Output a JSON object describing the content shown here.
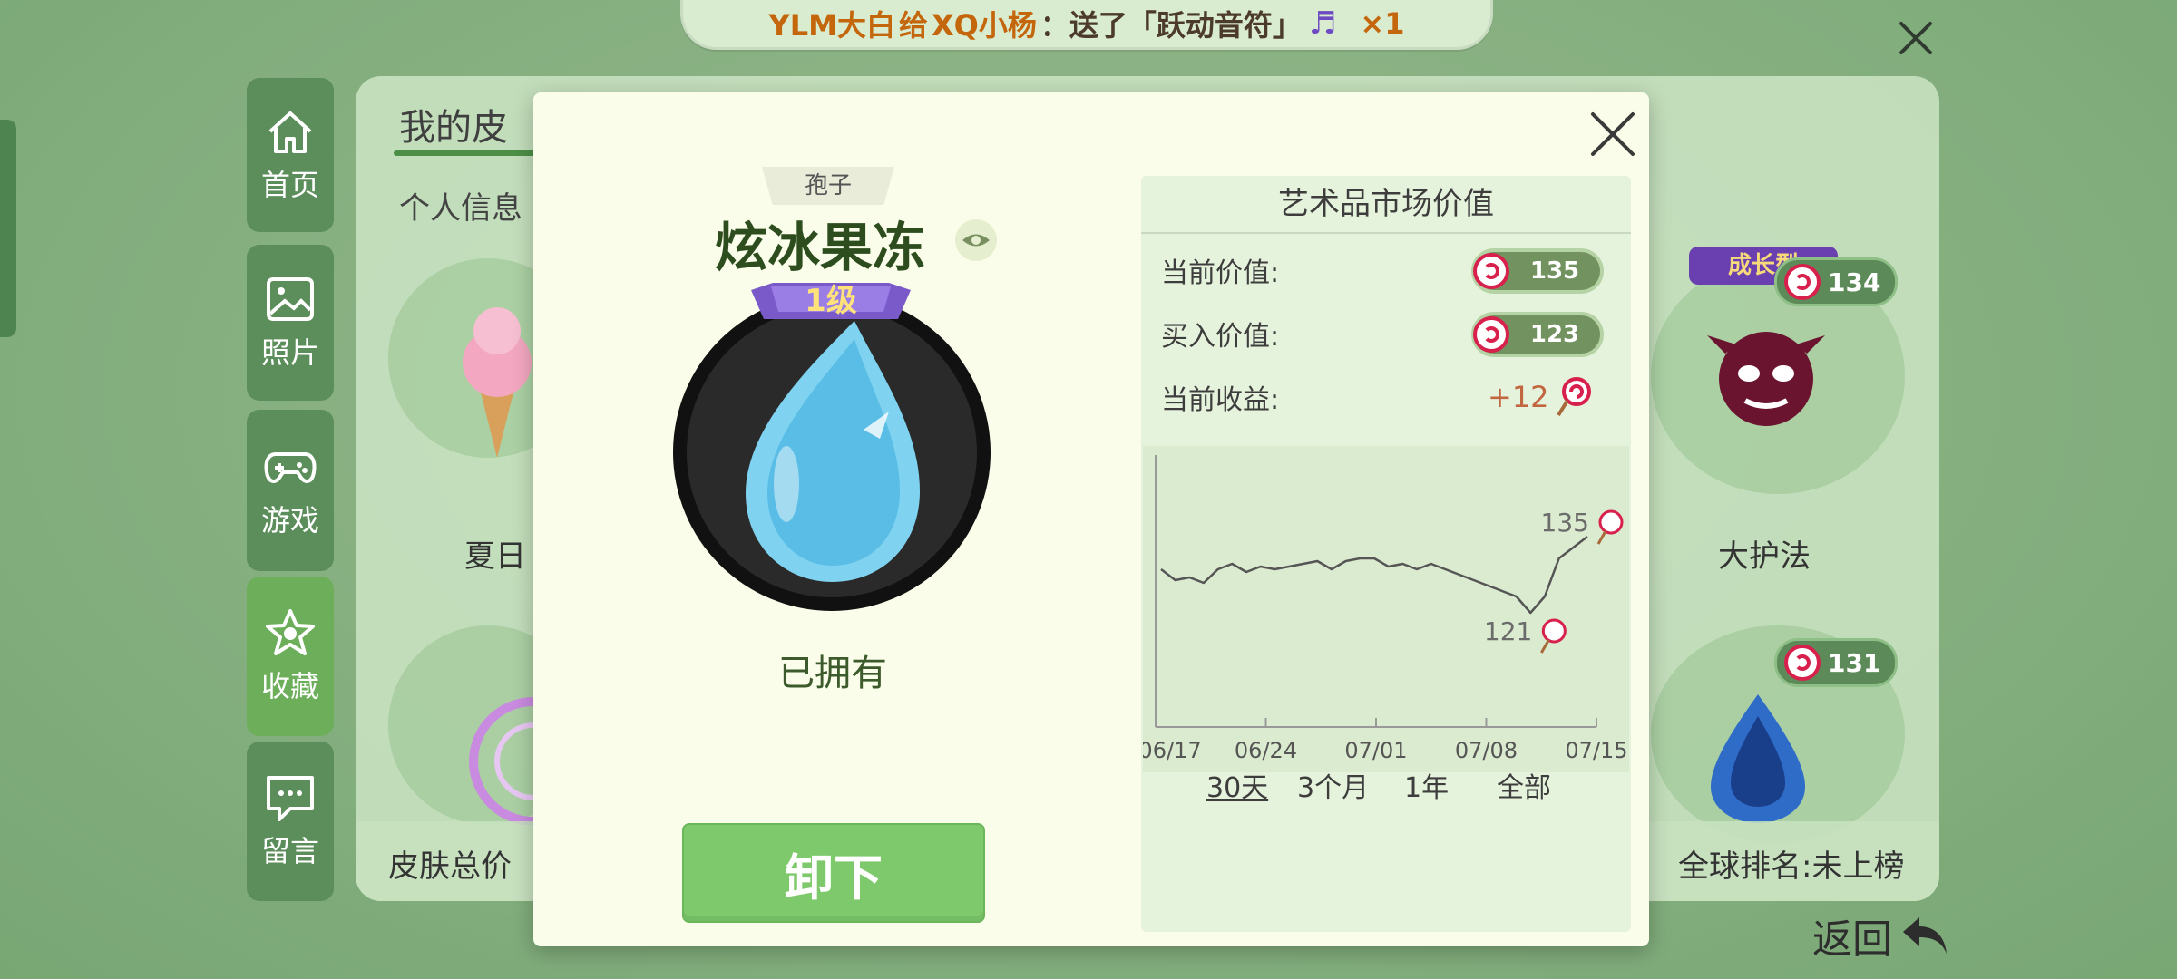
{
  "ticker": {
    "sender": "YLM大白",
    "verb": "给",
    "receiver": "XQ小杨",
    "message": "：送了「跃动音符」",
    "count": "×1"
  },
  "nav": [
    {
      "label": "首页",
      "icon": "home-icon"
    },
    {
      "label": "照片",
      "icon": "image-icon"
    },
    {
      "label": "游戏",
      "icon": "gamepad-icon"
    },
    {
      "label": "收藏",
      "icon": "star-icon"
    },
    {
      "label": "留言",
      "icon": "message-icon"
    }
  ],
  "background": {
    "title": "我的皮",
    "subtitle": "个人信息",
    "items": [
      {
        "label": "夏日"
      },
      {
        "label": "大护法",
        "value": "134",
        "tag": "成长型"
      },
      {
        "value": "131"
      }
    ],
    "footer_left": "皮肤总价",
    "footer_right": "全球排名:未上榜",
    "return_label": "返回"
  },
  "dialog": {
    "type_tag": "孢子",
    "skin_name": "炫冰果冻",
    "level": "1级",
    "owned": "已拥有",
    "action_button": "卸下",
    "market": {
      "title": "艺术品市场价值",
      "current_value_label": "当前价值:",
      "current_value": "135",
      "buy_value_label": "买入价值:",
      "buy_value": "123",
      "gain_label": "当前收益:",
      "gain": "+12",
      "tabs": [
        "30天",
        "3个月",
        "1年",
        "全部"
      ],
      "selected_tab": "30天"
    }
  },
  "chart_data": {
    "type": "line",
    "x_ticks": [
      "06/17",
      "06/24",
      "07/01",
      "07/08",
      "07/15"
    ],
    "series": [
      {
        "values": [
          129,
          127,
          127.5,
          126.5,
          129,
          130,
          128.5,
          129.5,
          129,
          129.5,
          130,
          130.5,
          129,
          130.5,
          131,
          131,
          129.5,
          130,
          129,
          130,
          129,
          128,
          127,
          126,
          125,
          124,
          121,
          124,
          131,
          133,
          135
        ]
      }
    ],
    "annotations": [
      {
        "label": "135",
        "x": 30,
        "y": 135
      },
      {
        "label": "121",
        "x": 26,
        "y": 121
      }
    ],
    "ylim": [
      100,
      150
    ],
    "colors": {
      "line": "#555555",
      "annotation": "#6b6b6b"
    }
  },
  "colors": {
    "accent_green": "#7dc96b",
    "nav_green": "#5b8e5a",
    "candy_red": "#d8204d",
    "gain_orange": "#c26640"
  }
}
